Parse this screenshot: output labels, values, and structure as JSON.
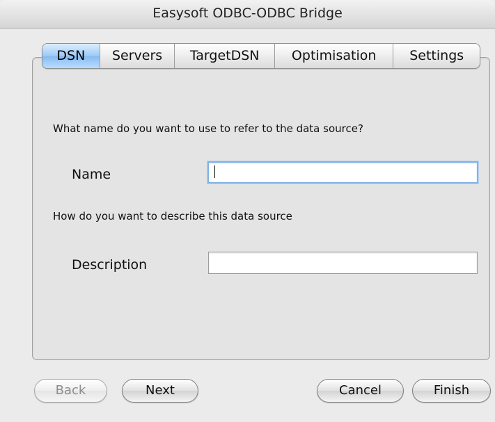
{
  "window": {
    "title": "Easysoft ODBC-ODBC Bridge"
  },
  "tabs": [
    {
      "label": "DSN",
      "active": true
    },
    {
      "label": "Servers",
      "active": false
    },
    {
      "label": "TargetDSN",
      "active": false
    },
    {
      "label": "Optimisation",
      "active": false
    },
    {
      "label": "Settings",
      "active": false
    }
  ],
  "form": {
    "name_prompt": "What name do you want to use to refer to the data source?",
    "name_label": "Name",
    "name_value": "",
    "description_prompt": "How do you want to describe this data source",
    "description_label": "Description",
    "description_value": ""
  },
  "buttons": {
    "back": "Back",
    "next": "Next",
    "cancel": "Cancel",
    "finish": "Finish"
  },
  "colors": {
    "active_tab": "#8dc1f2",
    "focus_ring": "#7fb3e8"
  }
}
